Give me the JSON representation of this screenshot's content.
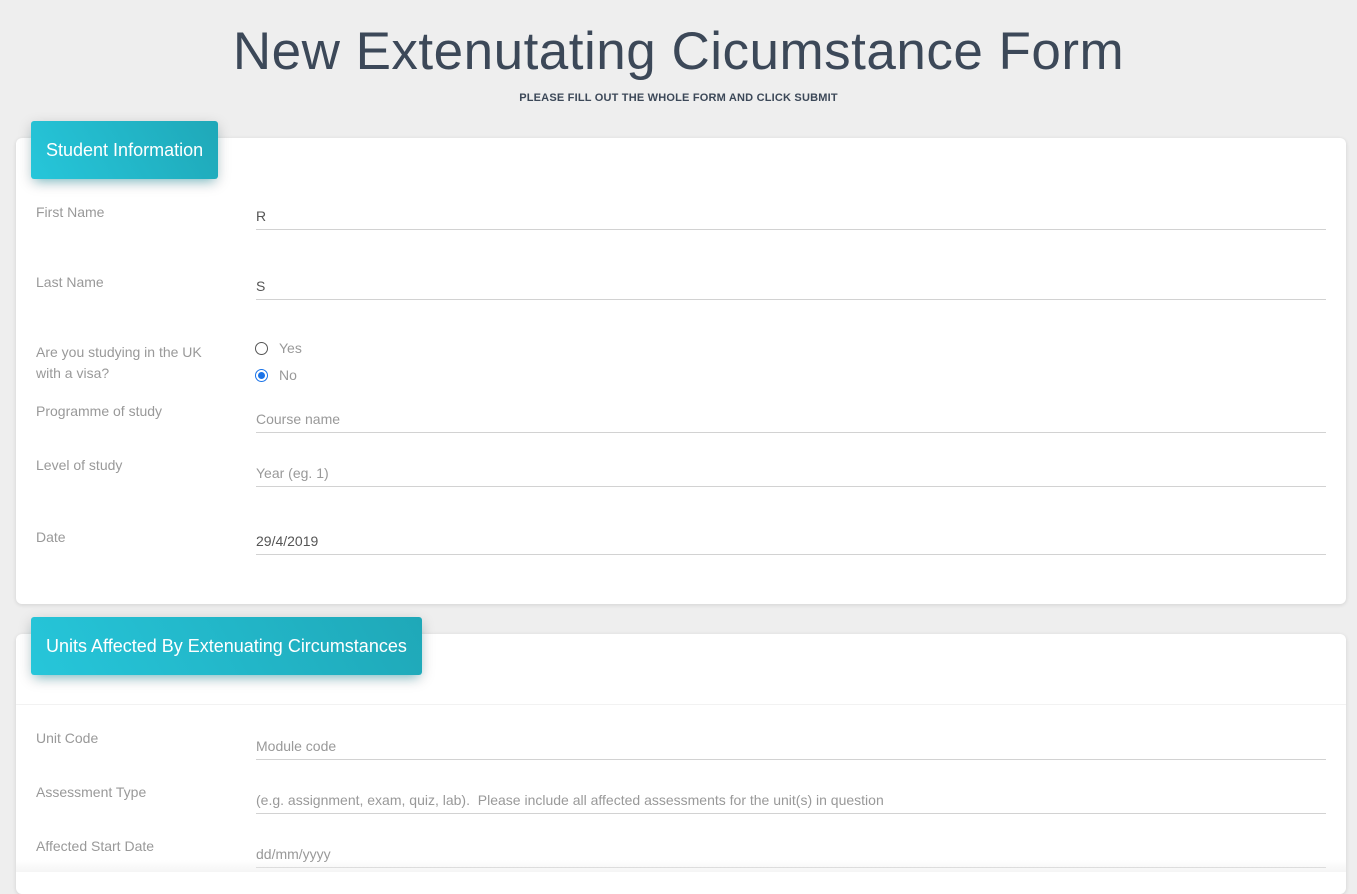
{
  "header": {
    "title": "New Extenutating Cicumstance Form",
    "subtitle": "PLEASE FILL OUT THE WHOLE FORM AND CLICK SUBMIT"
  },
  "student_info": {
    "heading": "Student Information",
    "first_name": {
      "label": "First Name",
      "value": "R"
    },
    "last_name": {
      "label": "Last Name",
      "value": "S"
    },
    "visa": {
      "label": "Are you studying in the UK with a visa?",
      "options": [
        {
          "label": "Yes",
          "checked": false
        },
        {
          "label": "No",
          "checked": true
        }
      ]
    },
    "programme": {
      "label": "Programme of study",
      "value": "",
      "placeholder": "Course name"
    },
    "level": {
      "label": "Level of study",
      "value": "",
      "placeholder": "Year (eg. 1)"
    },
    "date": {
      "label": "Date",
      "value": "29/4/2019"
    }
  },
  "units": {
    "heading": "Units Affected By Extenuating Circumstances",
    "unit_code": {
      "label": "Unit Code",
      "value": "",
      "placeholder": "Module code"
    },
    "assessment_type": {
      "label": "Assessment Type",
      "value": "",
      "placeholder": "(e.g. assignment, exam, quiz, lab).  Please include all affected assessments for the unit(s) in question"
    },
    "affected_start_date": {
      "label": "Affected Start Date",
      "value": "",
      "placeholder": "dd/mm/yyyy"
    }
  },
  "colors": {
    "accent": "#26c6da",
    "radio_checked": "#1a73e8",
    "background": "#eeeeee"
  }
}
